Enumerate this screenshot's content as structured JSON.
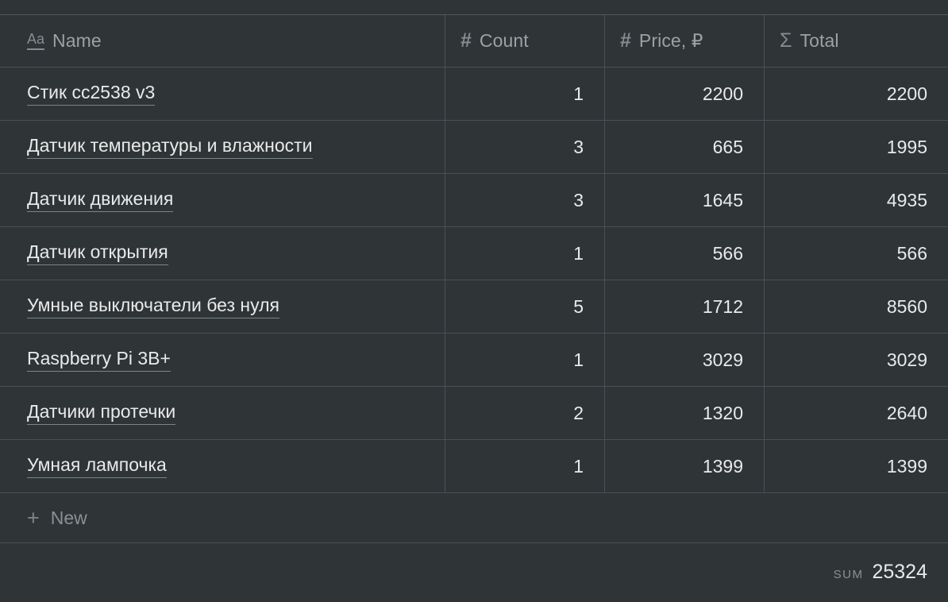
{
  "table": {
    "columns": [
      {
        "label": "Name",
        "icon": "text-aa-icon",
        "type": "text"
      },
      {
        "label": "Count",
        "icon": "hash-icon",
        "type": "number"
      },
      {
        "label": "Price, ₽",
        "icon": "hash-icon",
        "type": "number"
      },
      {
        "label": "Total",
        "icon": "sigma-icon",
        "type": "formula"
      }
    ],
    "rows": [
      {
        "name": "Стик cc2538 v3",
        "count": "1",
        "price": "2200",
        "total": "2200"
      },
      {
        "name": "Датчик температуры и влажности",
        "count": "3",
        "price": "665",
        "total": "1995"
      },
      {
        "name": "Датчик движения",
        "count": "3",
        "price": "1645",
        "total": "4935"
      },
      {
        "name": "Датчик открытия",
        "count": "1",
        "price": "566",
        "total": "566"
      },
      {
        "name": "Умные выключатели без нуля",
        "count": "5",
        "price": "1712",
        "total": "8560"
      },
      {
        "name": "Raspberry Pi 3B+",
        "count": "1",
        "price": "3029",
        "total": "3029"
      },
      {
        "name": "Датчики протечки",
        "count": "2",
        "price": "1320",
        "total": "2640"
      },
      {
        "name": "Умная лампочка",
        "count": "1",
        "price": "1399",
        "total": "1399"
      }
    ],
    "new_row": {
      "label": "New",
      "icon": "plus-icon"
    },
    "summary": {
      "label": "SUM",
      "value": "25324"
    }
  },
  "glyphs": {
    "aa": "Aa",
    "hash": "#",
    "sigma": "Σ",
    "plus": "+"
  },
  "colors": {
    "background": "#2f3437",
    "border": "#4a5053",
    "text_primary": "#e9eaea",
    "text_muted": "#9ca1a4",
    "icon": "#868c90"
  }
}
